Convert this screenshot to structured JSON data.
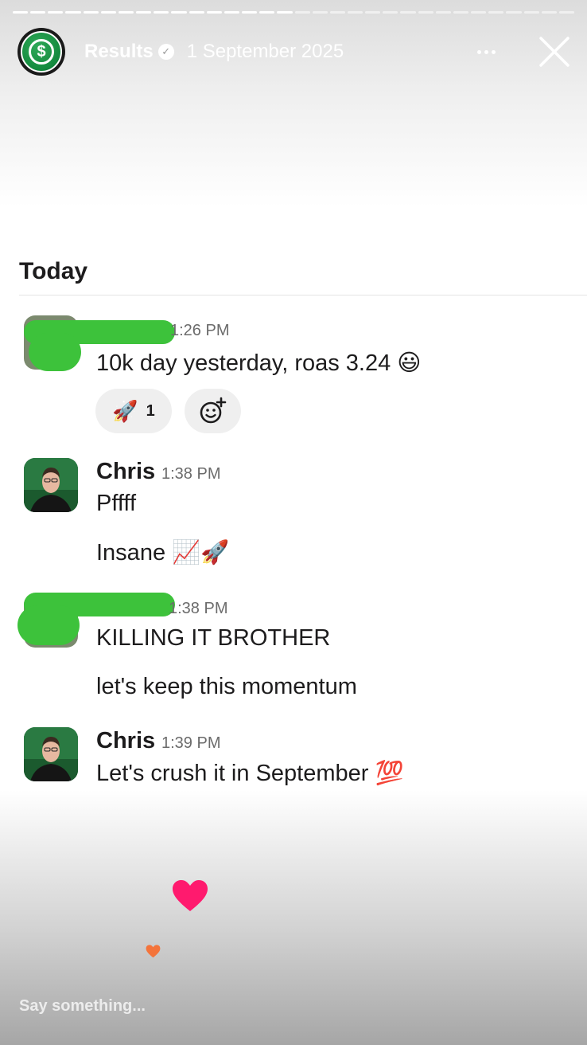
{
  "story": {
    "name": "Results",
    "date": "1 September 2025",
    "avatar_icon": "dollar-icon",
    "progress_segments": 2,
    "active_segment": 0
  },
  "chat": {
    "day_label": "Today",
    "messages": [
      {
        "author": "",
        "time": "1:26 PM",
        "lines": [
          "10k day yesterday, roas 3.24 😃"
        ],
        "reactions": [
          {
            "emoji": "🚀",
            "count": "1"
          }
        ]
      },
      {
        "author": "Chris",
        "time": "1:38 PM",
        "lines": [
          "Pffff",
          "Insane 📈🚀"
        ]
      },
      {
        "author": "",
        "time": "1:38 PM",
        "lines": [
          "KILLING IT BROTHER",
          "let's keep this momentum"
        ]
      },
      {
        "author": "Chris",
        "time": "1:39 PM",
        "lines": [
          "Let's crush it in September 💯"
        ]
      }
    ]
  },
  "reply": {
    "placeholder": "Say something..."
  },
  "colors": {
    "heart": "#ff1a6e",
    "small_heart": "#f4743b",
    "redaction_scribble": "#3dc23b"
  }
}
